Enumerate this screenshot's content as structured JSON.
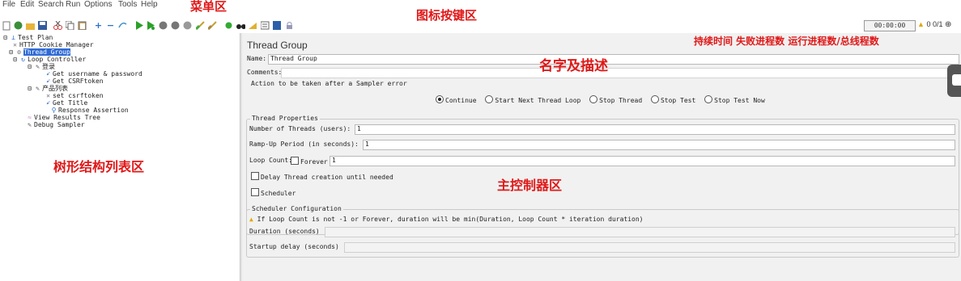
{
  "menu": [
    "File",
    "Edit",
    "Search",
    "Run",
    "Options",
    "Tools",
    "Help"
  ],
  "annotations": {
    "menu_area": "菜单区",
    "toolbar_area": "图标按键区",
    "status_area": "持续时间 失败进程数 运行进程数/总线程数",
    "name_area": "名字及描述",
    "tree_area": "树形结构列表区",
    "controller_area": "主控制器区"
  },
  "status": {
    "duration": "00:00:00",
    "errors": "0",
    "threads": "0/1"
  },
  "tree": {
    "test_plan": "Test Plan",
    "cookie_manager": "HTTP Cookie Manager",
    "thread_group": "Thread Group",
    "loop_controller": "Loop Controller",
    "login": "登录",
    "get_user": "Get username & password",
    "get_csrf": "Get CSRFtoken",
    "product_list": "产品列表",
    "set_csrf": "set csrftoken",
    "get_title": "Get Title",
    "assertion": "Response Assertion",
    "results_tree": "View Results Tree",
    "debug_sampler": "Debug Sampler"
  },
  "main": {
    "title": "Thread Group",
    "name_label": "Name:",
    "name_value": "Thread Group",
    "comments_label": "Comments:",
    "comments_value": "",
    "error_action_label": "Action to be taken after a Sampler error",
    "error_actions": [
      "Continue",
      "Start Next Thread Loop",
      "Stop Thread",
      "Stop Test",
      "Stop Test Now"
    ],
    "selected_error_action": "Continue",
    "thread_props_legend": "Thread Properties",
    "num_threads_label": "Number of Threads (users):",
    "num_threads_value": "1",
    "rampup_label": "Ramp-Up Period (in seconds):",
    "rampup_value": "1",
    "loop_count_label": "Loop Count:",
    "forever_label": "Forever",
    "forever_checked": false,
    "loop_count_value": "1",
    "delay_label": "Delay Thread creation until needed",
    "delay_checked": false,
    "scheduler_label": "Scheduler",
    "scheduler_checked": false,
    "sched_legend": "Scheduler Configuration",
    "sched_warning": "If Loop Count is not -1 or Forever, duration will be min(Duration, Loop Count * iteration duration)",
    "duration_label": "Duration (seconds)",
    "duration_value": "",
    "startup_delay_label": "Startup delay (seconds)",
    "startup_delay_value": ""
  },
  "colors": {
    "annotation": "#e01818",
    "selection": "#2f6bd6",
    "panel_bg": "#f1f1f1"
  }
}
